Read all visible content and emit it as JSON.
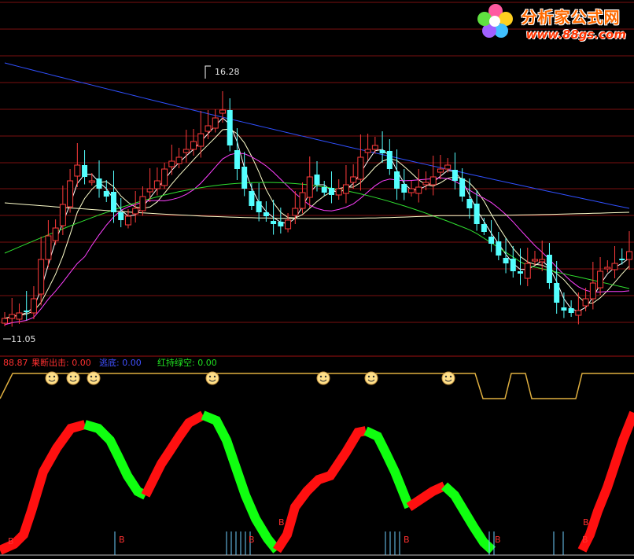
{
  "logo": {
    "title": "分析家公式网",
    "url": "www.88gs.com"
  },
  "price_panel": {
    "high_label": "16.28",
    "low_label": "11.05"
  },
  "indicator_panel": {
    "value": "88.87",
    "items": [
      {
        "label": "果断出击: 0.00",
        "color": "#ff3030"
      },
      {
        "label": "逃底: 0.00",
        "color": "#4040ff"
      },
      {
        "label": "红持绿空: 0.00",
        "color": "#20e020"
      }
    ]
  },
  "colors": {
    "up": "#ff3b3b",
    "down": "#54ffff",
    "ma5": "#ffffff",
    "ma10": "#ffffcc",
    "ma20": "#ff40ff",
    "ma60": "#30e030",
    "ma120": "#ffffcc",
    "ma250": "#3050ff",
    "grid": "#7a1010",
    "band": "#e0b040",
    "red": "#ff1010",
    "green": "#10ff10"
  },
  "chart_data": {
    "type": "candlestick",
    "annotations": [
      "16.28",
      "11.05"
    ],
    "series_lines": [
      "MA5",
      "MA10",
      "MA20",
      "MA60",
      "MA120",
      "MA250"
    ],
    "sub_charts": [
      "smiley-band",
      "red-green-step"
    ],
    "b_markers": 8
  }
}
